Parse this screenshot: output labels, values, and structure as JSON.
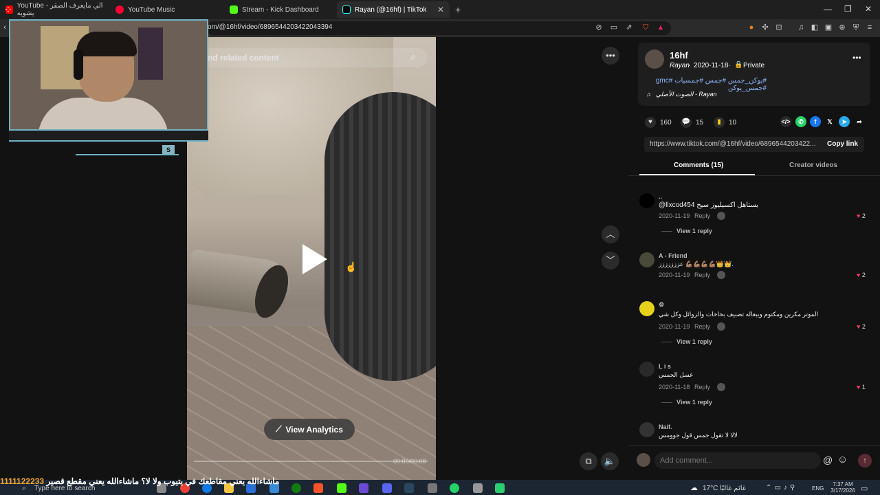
{
  "browser": {
    "tabs": [
      {
        "label": "YouTube - الي مايعرف الصقر يشويه",
        "active": false,
        "icon": "youtube-icon"
      },
      {
        "label": "YouTube Music",
        "active": false,
        "icon": "youtube-music-icon"
      },
      {
        "label": "Stream - Kick Dashboard",
        "active": false,
        "icon": "kick-icon"
      },
      {
        "label": "Rayan (@16hf) | TikTok",
        "active": true,
        "icon": "tiktok-icon"
      }
    ],
    "new_tab": "+",
    "url": "om/@16hf/video/6896544203422043394"
  },
  "video": {
    "search_placeholder": "nd related content",
    "analytics_label": "View Analytics",
    "time": "00:00/00:08"
  },
  "post": {
    "username": "16hf",
    "display_name": "Rayan",
    "date": "2020-11-18",
    "visibility": "Private",
    "hashtags": "#يوكن_جمس #جمس #جمسيات #gmc #جمس_يوكن",
    "sound": "الصوت الأصلي - Rayan",
    "likes": "160",
    "comments": "15",
    "saves": "10",
    "link": "https://www.tiktok.com/@16hf/video/6896544203422...",
    "copy_link": "Copy link",
    "tabs": {
      "comments": "Comments (15)",
      "creator": "Creator videos"
    }
  },
  "comments": [
    {
      "name": "..",
      "text": "@llxcod454 يستاهل اكسيليوز سيح",
      "date": "2020-11-19",
      "reply": "Reply",
      "likes": "2",
      "view_replies": "View 1 reply"
    },
    {
      "name": "A - Friend",
      "text": "عززززززز 💪🏽💪🏽💪🏽💪🏽👑👑.",
      "date": "2020-11-19",
      "reply": "Reply",
      "likes": "2",
      "view_replies": ""
    },
    {
      "name": "⚙",
      "text": "الموتر مكرين ومكتوم ويبغاله تضبيف بخاخات والزوائل وكل شي",
      "date": "2020-11-19",
      "reply": "Reply",
      "likes": "2",
      "view_replies": "View 1 reply"
    },
    {
      "name": "L i s",
      "text": "غسل الجمس",
      "date": "2020-11-18",
      "reply": "Reply",
      "likes": "1",
      "view_replies": "View 1 reply"
    },
    {
      "name": "Naif.",
      "text": "لالا لا تقول جمس قول جوومس",
      "date": "",
      "reply": "",
      "likes": "",
      "view_replies": ""
    }
  ],
  "comment_box": {
    "placeholder": "Add comment...",
    "at": "@",
    "emoji": "☺"
  },
  "overlay": {
    "ticker_num": "1111122233",
    "ticker_text": "ماشاءالله يعني مقاطعك في يتيوب ولا لا؟ ماشاءالله يعني مقطع قصير"
  },
  "taskbar": {
    "search": "Type here to search",
    "weather": "17°C  غائم غالبًا",
    "lang": "ENG",
    "time": "7:37 AM",
    "date": "3/17/2026"
  },
  "webcam": {
    "tag": "S"
  }
}
